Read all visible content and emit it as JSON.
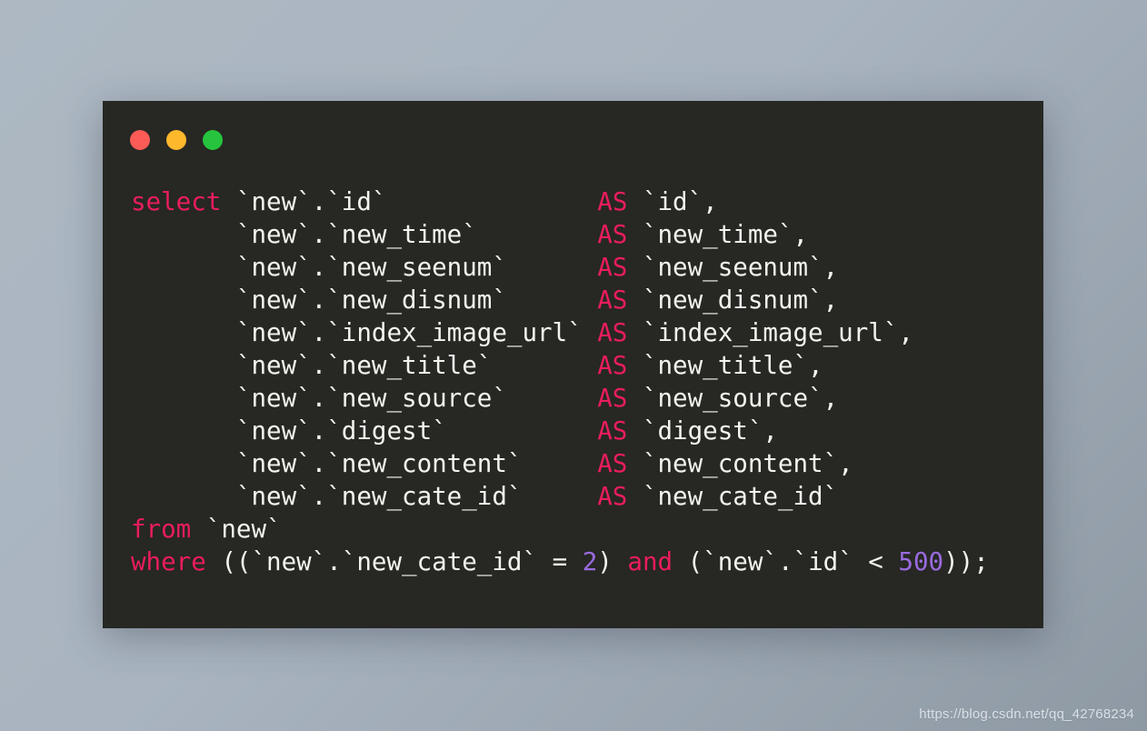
{
  "window": {
    "background_color": "#a9b4c0",
    "panel_color": "#272724",
    "controls": [
      {
        "name": "close",
        "label": "",
        "color": "#fc5b57"
      },
      {
        "name": "minimize",
        "label": "",
        "color": "#fdb82c"
      },
      {
        "name": "maximize",
        "label": "",
        "color": "#26c43c"
      }
    ]
  },
  "theme": {
    "keyword_color": "#ea1d5d",
    "identifier_color": "#f4f4ef",
    "number_color": "#9a6be0"
  },
  "code": {
    "language": "sql",
    "full_text": "select `new`.`id`              AS `id`,\n       `new`.`new_time`        AS `new_time`,\n       `new`.`new_seenum`      AS `new_seenum`,\n       `new`.`new_disnum`      AS `new_disnum`,\n       `new`.`index_image_url` AS `index_image_url`,\n       `new`.`new_title`       AS `new_title`,\n       `new`.`new_source`      AS `new_source`,\n       `new`.`digest`          AS `digest`,\n       `new`.`new_content`     AS `new_content`,\n       `new`.`new_cate_id`     AS `new_cate_id`\nfrom `new`\nwhere ((`new`.`new_cate_id` = 2) and (`new`.`id` < 500));",
    "lines": [
      [
        {
          "t": "select ",
          "c": "kw"
        },
        {
          "t": "`new`.`id`              ",
          "c": "id"
        },
        {
          "t": "AS ",
          "c": "kw"
        },
        {
          "t": "`id`,",
          "c": "id"
        }
      ],
      [
        {
          "t": "       `new`.`new_time`        ",
          "c": "id"
        },
        {
          "t": "AS ",
          "c": "kw"
        },
        {
          "t": "`new_time`,",
          "c": "id"
        }
      ],
      [
        {
          "t": "       `new`.`new_seenum`      ",
          "c": "id"
        },
        {
          "t": "AS ",
          "c": "kw"
        },
        {
          "t": "`new_seenum`,",
          "c": "id"
        }
      ],
      [
        {
          "t": "       `new`.`new_disnum`      ",
          "c": "id"
        },
        {
          "t": "AS ",
          "c": "kw"
        },
        {
          "t": "`new_disnum`,",
          "c": "id"
        }
      ],
      [
        {
          "t": "       `new`.`index_image_url` ",
          "c": "id"
        },
        {
          "t": "AS ",
          "c": "kw"
        },
        {
          "t": "`index_image_url`,",
          "c": "id"
        }
      ],
      [
        {
          "t": "       `new`.`new_title`       ",
          "c": "id"
        },
        {
          "t": "AS ",
          "c": "kw"
        },
        {
          "t": "`new_title`,",
          "c": "id"
        }
      ],
      [
        {
          "t": "       `new`.`new_source`      ",
          "c": "id"
        },
        {
          "t": "AS ",
          "c": "kw"
        },
        {
          "t": "`new_source`,",
          "c": "id"
        }
      ],
      [
        {
          "t": "       `new`.`digest`          ",
          "c": "id"
        },
        {
          "t": "AS ",
          "c": "kw"
        },
        {
          "t": "`digest`,",
          "c": "id"
        }
      ],
      [
        {
          "t": "       `new`.`new_content`     ",
          "c": "id"
        },
        {
          "t": "AS ",
          "c": "kw"
        },
        {
          "t": "`new_content`,",
          "c": "id"
        }
      ],
      [
        {
          "t": "       `new`.`new_cate_id`     ",
          "c": "id"
        },
        {
          "t": "AS ",
          "c": "kw"
        },
        {
          "t": "`new_cate_id`",
          "c": "id"
        }
      ],
      [
        {
          "t": "from ",
          "c": "kw"
        },
        {
          "t": "`new`",
          "c": "id"
        }
      ],
      [
        {
          "t": "where ",
          "c": "kw"
        },
        {
          "t": "((`new`.`new_cate_id` = ",
          "c": "id"
        },
        {
          "t": "2",
          "c": "num"
        },
        {
          "t": ") ",
          "c": "id"
        },
        {
          "t": "and ",
          "c": "kw"
        },
        {
          "t": "(`new`.`id` < ",
          "c": "id"
        },
        {
          "t": "500",
          "c": "num"
        },
        {
          "t": "));",
          "c": "id"
        }
      ]
    ]
  },
  "watermark": {
    "text": "https://blog.csdn.net/qq_42768234"
  }
}
